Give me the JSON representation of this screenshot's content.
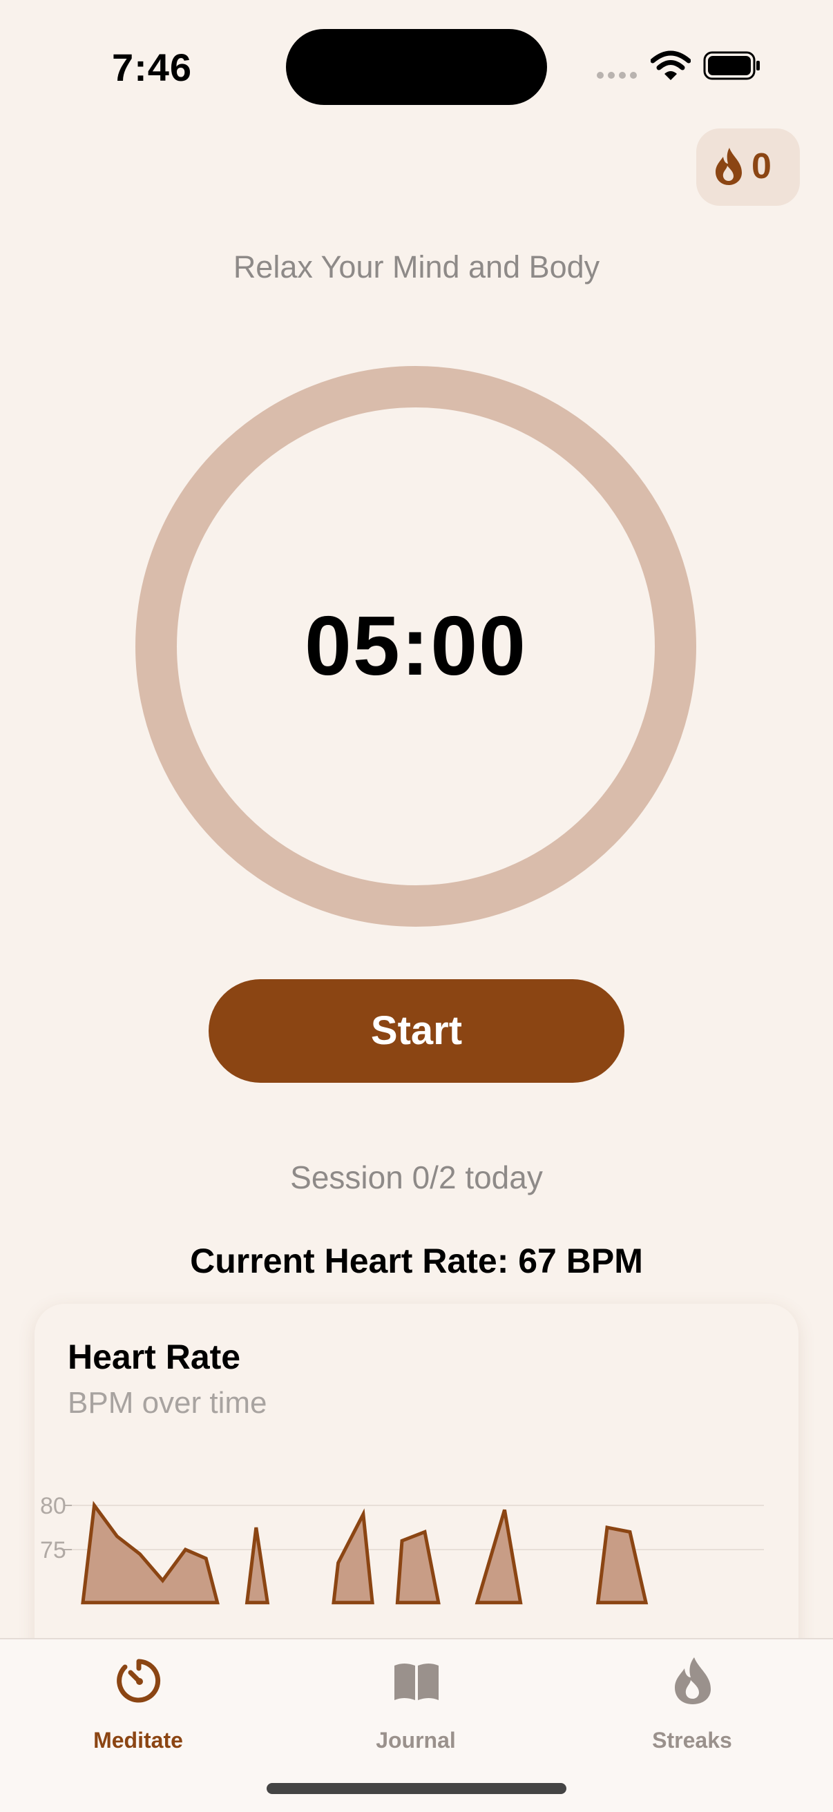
{
  "status_bar": {
    "time": "7:46"
  },
  "streak": {
    "count": "0",
    "icon": "flame-icon"
  },
  "header": {
    "subtitle": "Relax Your Mind and Body"
  },
  "timer": {
    "display": "05:00",
    "progress": 0
  },
  "actions": {
    "start_label": "Start"
  },
  "session": {
    "text": "Session 0/2 today"
  },
  "heart_rate": {
    "current_text": "Current Heart Rate: 67 BPM"
  },
  "card": {
    "title": "Heart Rate",
    "subtitle": "BPM over time"
  },
  "chart_data": {
    "type": "area",
    "title": "Heart Rate",
    "subtitle": "BPM over time",
    "ylabel": "",
    "xlabel": "",
    "y_ticks": [
      80,
      75
    ],
    "ylim": [
      69,
      81
    ],
    "grid": true,
    "series": [
      {
        "segments": [
          [
            [
              0.0,
              69
            ],
            [
              0.5,
              80
            ],
            [
              1.5,
              76.5
            ],
            [
              2.5,
              74.5
            ],
            [
              3.5,
              71.5
            ],
            [
              4.5,
              75
            ],
            [
              5.4,
              74
            ],
            [
              5.9,
              69
            ]
          ],
          [
            [
              7.2,
              69
            ],
            [
              7.6,
              77.5
            ],
            [
              8.1,
              69
            ]
          ],
          [
            [
              11.0,
              69
            ],
            [
              11.2,
              73.5
            ],
            [
              12.3,
              79
            ],
            [
              12.7,
              69
            ]
          ],
          [
            [
              13.8,
              69
            ],
            [
              14.0,
              76
            ],
            [
              15.0,
              77
            ],
            [
              15.6,
              69
            ]
          ],
          [
            [
              17.3,
              69
            ],
            [
              18.5,
              79.5
            ],
            [
              19.2,
              69
            ]
          ],
          [
            [
              22.6,
              69
            ],
            [
              23.0,
              77.5
            ],
            [
              24.0,
              77
            ],
            [
              24.7,
              69
            ]
          ]
        ]
      }
    ],
    "colors": {
      "fill": "#C89D86",
      "stroke": "#8B4513",
      "grid": "#E8DFD8"
    }
  },
  "tabbar": {
    "items": [
      {
        "label": "Meditate",
        "icon": "timer-icon",
        "active": true
      },
      {
        "label": "Journal",
        "icon": "book-icon",
        "active": false
      },
      {
        "label": "Streaks",
        "icon": "flame-icon",
        "active": false
      }
    ]
  },
  "colors": {
    "accent": "#8B4513",
    "background": "#F9F2EC",
    "ring": "#D9BCAB",
    "muted_text": "#8E8A88",
    "inactive_tab": "#9A918C"
  }
}
